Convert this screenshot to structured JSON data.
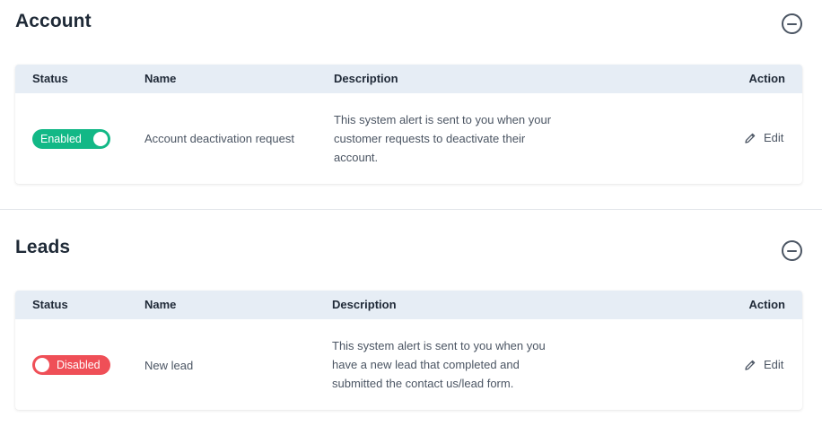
{
  "sections": [
    {
      "title": "Account",
      "columns": {
        "status": "Status",
        "name": "Name",
        "description": "Description",
        "action": "Action"
      },
      "rows": [
        {
          "status": "Enabled",
          "enabled": true,
          "name": "Account deactivation request",
          "description_lines": [
            "This system alert is sent to you when your",
            "customer requests to deactivate their",
            "account."
          ],
          "action": "Edit"
        }
      ]
    },
    {
      "title": "Leads",
      "columns": {
        "status": "Status",
        "name": "Name",
        "description": "Description",
        "action": "Action"
      },
      "rows": [
        {
          "status": "Disabled",
          "enabled": false,
          "name": "New lead",
          "description_lines": [
            "This system alert is sent to you when you",
            "have a new lead that completed and",
            "submitted the contact us/lead form."
          ],
          "action": "Edit"
        }
      ]
    }
  ],
  "colors": {
    "enabled": "#12b886",
    "disabled": "#ef4f57",
    "header_bg": "#e6edf5"
  },
  "icons": {
    "collapse": "minus-circle-icon",
    "edit": "pencil-icon"
  }
}
